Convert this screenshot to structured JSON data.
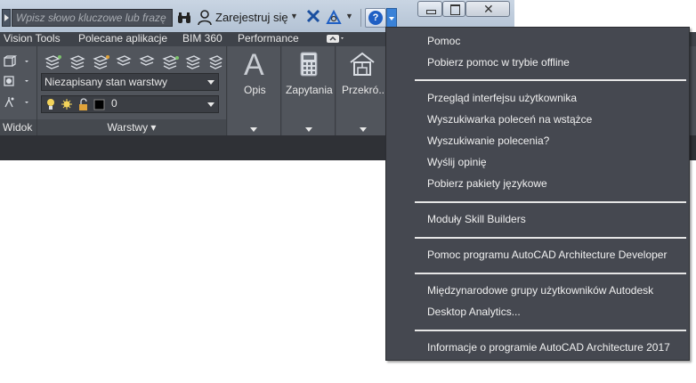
{
  "titlebar": {
    "search_placeholder": "Wpisz słowo kluczowe lub frazę",
    "register_label": "Zarejestruj się",
    "help_glyph": "?",
    "close_glyph": "✕"
  },
  "tabs": [
    "Vision Tools",
    "Polecane aplikacje",
    "BIM 360",
    "Performance"
  ],
  "ribbon": {
    "layer_state": "Niezapisany stan warstwy",
    "layer_current": "0",
    "widok_label": "Widok",
    "warstwy_label": "Warstwy",
    "opis_label": "Opis",
    "zapytania_label": "Zapytania",
    "przekroj_label": "Przekró..."
  },
  "help_menu": {
    "items": [
      "Pomoc",
      "Pobierz pomoc w trybie offline",
      "Przegląd interfejsu użytkownika",
      "Wyszukiwarka poleceń na wstążce",
      "Wyszukiwanie polecenia?",
      "Wyślij opinię",
      "Pobierz pakiety językowe",
      "Moduły Skill Builders",
      "Pomoc programu AutoCAD Architecture Developer",
      "Międzynarodowe grupy użytkowników Autodesk",
      "Desktop Analytics...",
      "Informacje o programie AutoCAD Architecture 2017"
    ]
  },
  "colors": {
    "ribbon_bg": "#4b4f56",
    "menu_bg": "#454850",
    "titlebar_bg": "#bcc9d8",
    "help_accent": "#1f5fc4"
  }
}
